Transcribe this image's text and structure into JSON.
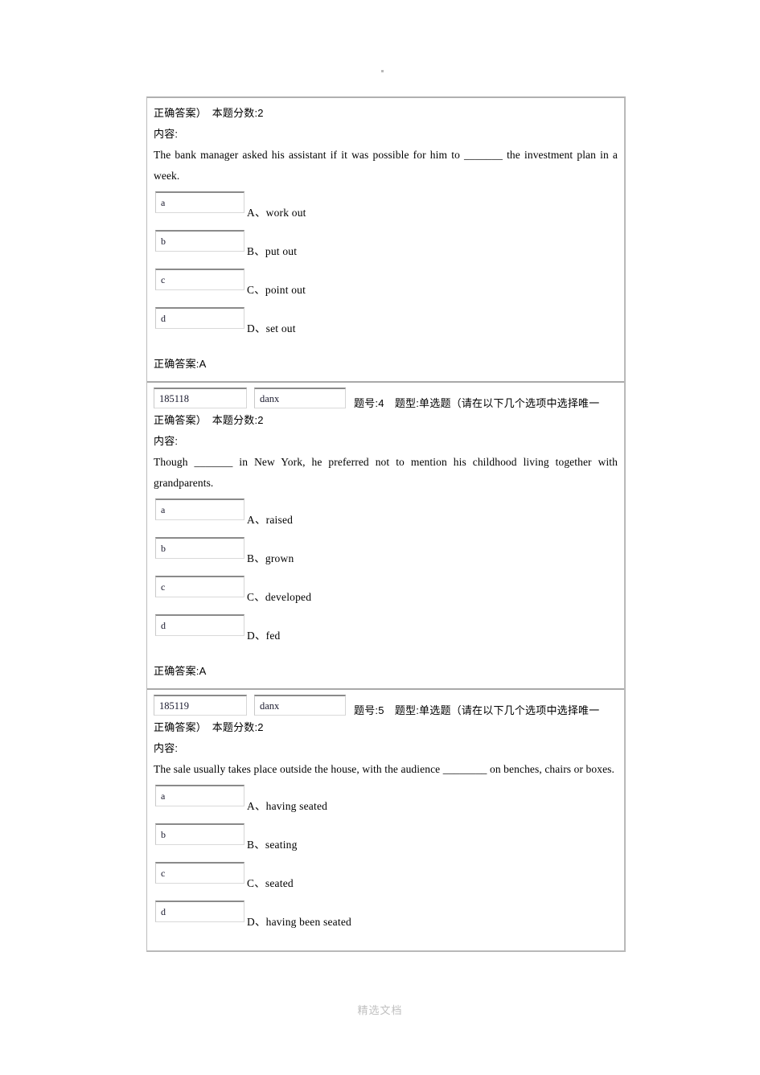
{
  "document": {
    "footer_watermark": "精选文档",
    "labels": {
      "content": "内容:",
      "score_prefix": "本题分数:",
      "answer_prefix": "正确答案:",
      "question_no_prefix": "题号:",
      "question_type_prefix": "题型:"
    }
  },
  "blocks": [
    {
      "continued_header": "正确答案）　本题分数:2",
      "content_label": "内容:",
      "question_text": "The bank manager asked his assistant if it was possible for him to _______ the investment plan in a week.",
      "options": [
        {
          "box_value": "a",
          "label": "A、work out"
        },
        {
          "box_value": "b",
          "label": "B、put out"
        },
        {
          "box_value": "c",
          "label": "C、point out"
        },
        {
          "box_value": "d",
          "label": "D、set out"
        }
      ],
      "correct_answer": "正确答案:A"
    },
    {
      "id_box": "185118",
      "type_box": "danx",
      "header_line1": "题号:4　题型:单选题（请在以下几个选项中选择唯一",
      "header_line2": "正确答案）　本题分数:2",
      "content_label": "内容:",
      "question_text": "Though _______ in New York, he preferred not to mention his childhood living together with grandparents.",
      "options": [
        {
          "box_value": "a",
          "label": "A、raised"
        },
        {
          "box_value": "b",
          "label": "B、grown"
        },
        {
          "box_value": "c",
          "label": "C、developed"
        },
        {
          "box_value": "d",
          "label": "D、fed"
        }
      ],
      "correct_answer": "正确答案:A"
    },
    {
      "id_box": "185119",
      "type_box": "danx",
      "header_line1": "题号:5　题型:单选题（请在以下几个选项中选择唯一",
      "header_line2": "正确答案）　本题分数:2",
      "content_label": "内容:",
      "question_text": "The sale usually takes place outside the house, with the audience ________ on benches, chairs or boxes.",
      "options": [
        {
          "box_value": "a",
          "label": "A、having seated"
        },
        {
          "box_value": "b",
          "label": "B、seating"
        },
        {
          "box_value": "c",
          "label": "C、seated"
        },
        {
          "box_value": "d",
          "label": "D、having been seated"
        }
      ],
      "correct_answer": ""
    }
  ]
}
